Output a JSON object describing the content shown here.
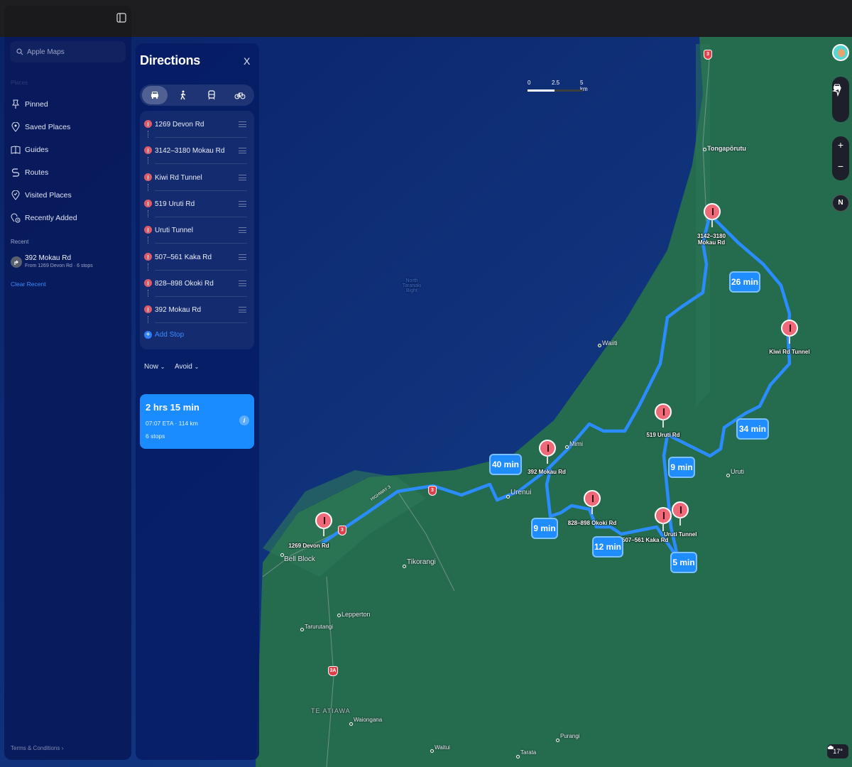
{
  "app": {
    "search_placeholder": "Apple Maps"
  },
  "sidebar": {
    "places_label": "Places",
    "items": [
      {
        "label": "Pinned",
        "icon": "pin-icon"
      },
      {
        "label": "Saved Places",
        "icon": "location-pin-icon"
      },
      {
        "label": "Guides",
        "icon": "book-icon"
      },
      {
        "label": "Routes",
        "icon": "route-icon"
      },
      {
        "label": "Visited Places",
        "icon": "visited-pin-icon"
      },
      {
        "label": "Recently Added",
        "icon": "recently-added-icon"
      }
    ],
    "recent_label": "Recent",
    "recent": {
      "title": "392 Mokau Rd",
      "subtitle": "From 1269 Devon Rd · 6 stops"
    },
    "clear_recent": "Clear Recent",
    "terms": "Terms & Conditions"
  },
  "directions": {
    "title": "Directions",
    "close": "X",
    "stops": [
      "1269 Devon Rd",
      "3142–3180 Mokau Rd",
      "Kiwi Rd Tunnel",
      "519 Uruti Rd",
      "Uruti Tunnel",
      "507–561 Kaka Rd",
      "828–898 Okoki Rd",
      "392 Mokau Rd"
    ],
    "add_stop": "Add Stop",
    "now": "Now",
    "avoid": "Avoid",
    "route": {
      "time": "2 hrs 15 min",
      "eta": "07:07 ETA · 114 km",
      "stops": "6 stops",
      "info": "i"
    }
  },
  "map": {
    "scale": [
      "0",
      "2.5",
      "5 km"
    ],
    "sea_label": "North Taranaki Bight",
    "places": [
      "Tongapōrutu",
      "Waiiti",
      "Mimi",
      "Urenui",
      "Uruti",
      "Bell Block",
      "Tikorangi",
      "Lepperton",
      "Tarurutangi",
      "TE ATIAWA",
      "Waiongana",
      "Purangi",
      "Waitui",
      "Tarata"
    ],
    "highway_label": "HIGHWAY 3",
    "stop_labels": [
      "3142–3180 Mokau Rd",
      "Kiwi Rd Tunnel",
      "519 Uruti Rd",
      "392 Mokau Rd",
      "828–898 Okoki Rd",
      "507–561 Kaka Rd",
      "Uruti Tunnel",
      "1269 Devon Rd"
    ],
    "times": [
      "26 min",
      "34 min",
      "40 min",
      "9 min",
      "9 min",
      "12 min",
      "5 min"
    ],
    "shields": [
      "3",
      "3",
      "3",
      "3",
      "3A"
    ],
    "compass": "N",
    "weather": "17°",
    "colors": {
      "route": "#2a8cff",
      "land": "#256b4e",
      "sea": "#0e2f7a",
      "pin": "#ef6a78"
    }
  }
}
